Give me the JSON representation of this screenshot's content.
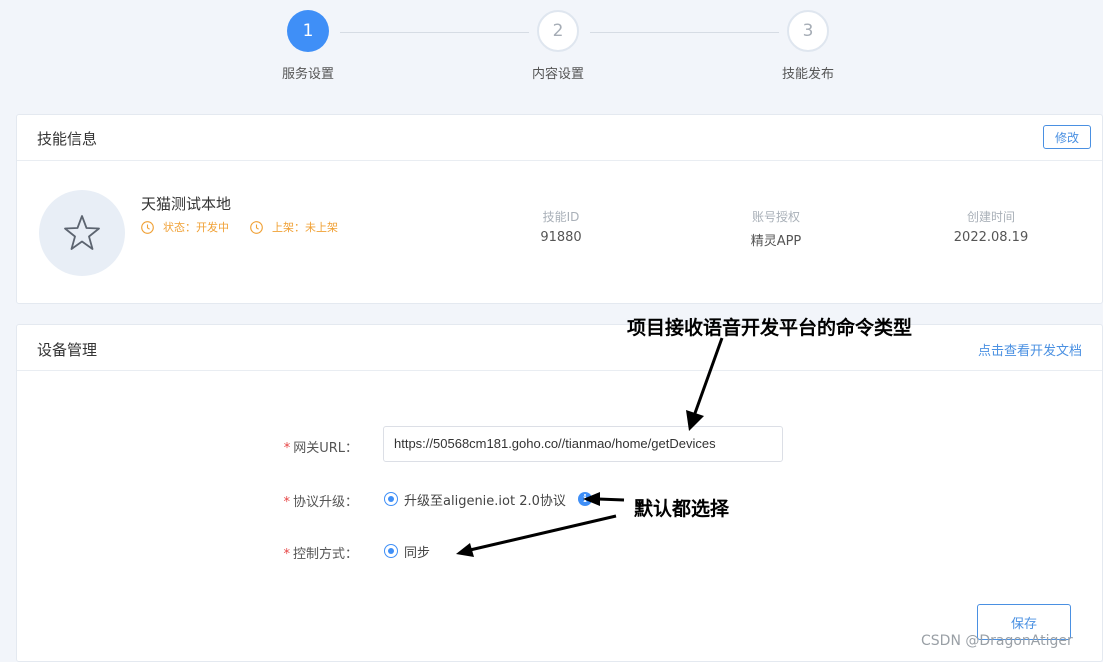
{
  "stepper": {
    "steps": [
      {
        "number": "1",
        "label": "服务设置",
        "state": "active"
      },
      {
        "number": "2",
        "label": "内容设置",
        "state": "idle"
      },
      {
        "number": "3",
        "label": "技能发布",
        "state": "idle"
      }
    ]
  },
  "skill_info": {
    "title": "技能信息",
    "edit_label": "修改",
    "avatar_icon": "star-icon",
    "name": "天猫测试本地",
    "status_text": "状态：开发中",
    "listing_text": "上架：未上架",
    "meta": [
      {
        "label": "技能ID",
        "value": "91880"
      },
      {
        "label": "账号授权",
        "value": "精灵APP"
      },
      {
        "label": "创建时间",
        "value": "2022.08.19"
      }
    ]
  },
  "device_mgmt": {
    "title": "设备管理",
    "doc_link": "点击查看开发文档",
    "gateway_label": "网关URL：",
    "gateway_value": "https://50568cm181.goho.co//tianmao/home/getDevices",
    "protocol_label": "协议升级：",
    "protocol_option": "升级至aligenie.iot 2.0协议",
    "control_label": "控制方式：",
    "control_option": "同步",
    "required_mark": "*",
    "save_label": "保存"
  },
  "annotations": {
    "top": "项目接收语音开发平台的命令类型",
    "side": "默认都选择"
  },
  "watermark": "CSDN @DragonAtiger",
  "colors": {
    "accent": "#3f8ff7",
    "warning": "#f0a136",
    "required": "#e64545"
  }
}
